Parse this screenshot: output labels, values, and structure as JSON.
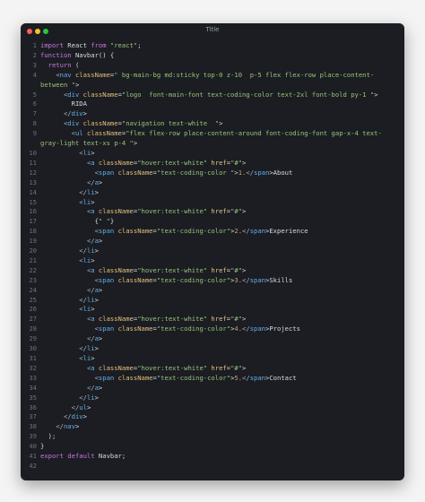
{
  "window": {
    "title": "Title"
  },
  "code": {
    "lines": [
      "import React from \"react\";",
      "function Navbar() {",
      "  return (",
      "    <nav className=\" bg-main-bg md:sticky top-0 z-10  p-5 flex flex-row place-content-between \">",
      "      <div className=\"logo  font-main-font text-coding-color text-2xl font-bold py-1 \">",
      "        RIDA",
      "      </div>",
      "      <div className=\"navigation text-white  \">",
      "        <ul className=\"flex flex-row place-content-around font-coding-font gap-x-4 text-gray-light text-xs p-4 \">",
      "          <li>",
      "            <a className=\"hover:text-white\" href=\"#\">",
      "              <span className=\"text-coding-color \">1.</span>About",
      "            </a>",
      "          </li>",
      "          <li>",
      "            <a className=\"hover:text-white\" href=\"#\">",
      "              {\" \"}",
      "              <span className=\"text-coding-color\">2.</span>Experience",
      "            </a>",
      "          </li>",
      "          <li>",
      "            <a className=\"hover:text-white\" href=\"#\">",
      "              <span className=\"text-coding-color\">3.</span>Skills",
      "            </a>",
      "          </li>",
      "          <li>",
      "            <a className=\"hover:text-white\" href=\"#\">",
      "              <span className=\"text-coding-color\">4.</span>Projects",
      "            </a>",
      "          </li>",
      "          <li>",
      "            <a className=\"hover:text-white\" href=\"#\">",
      "              <span className=\"text-coding-color\">5.</span>Contact",
      "            </a>",
      "          </li>",
      "        </ul>",
      "      </div>",
      "    </nav>",
      "  );",
      "}",
      "export default Navbar;",
      ""
    ]
  }
}
